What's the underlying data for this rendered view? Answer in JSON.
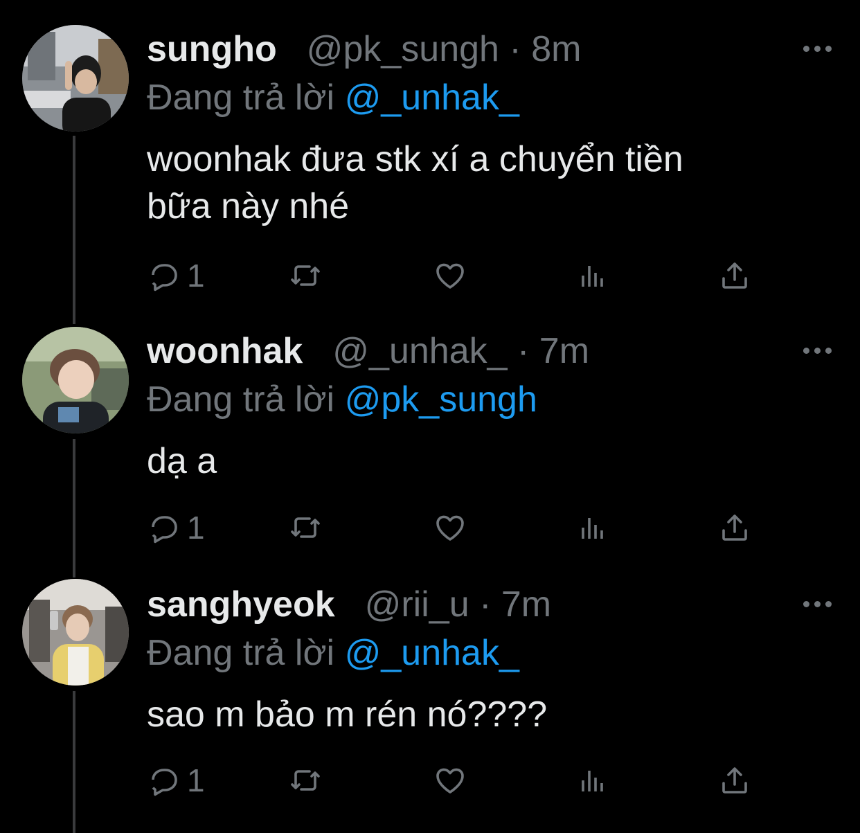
{
  "tweets": [
    {
      "display_name": "sungho",
      "handle": "@pk_sungh",
      "separator": "·",
      "time": "8m",
      "reply_prefix": "Đang trả lời",
      "reply_handle": "@_unhak_",
      "text_lines": [
        "woonhak đưa stk xí a chuyển tiền",
        "bữa này nhé"
      ],
      "reply_count": "1"
    },
    {
      "display_name": "woonhak",
      "handle": "@_unhak_",
      "separator": "·",
      "time": "7m",
      "reply_prefix": "Đang trả lời",
      "reply_handle": "@pk_sungh",
      "text_lines": [
        "dạ a"
      ],
      "reply_count": "1"
    },
    {
      "display_name": "sanghyeok",
      "handle": "@rii_u",
      "separator": "·",
      "time": "7m",
      "reply_prefix": "Đang trả lời",
      "reply_handle": "@_unhak_",
      "text_lines": [
        "sao m bảo m rén nó????"
      ],
      "reply_count": "1"
    }
  ],
  "icons": {
    "reply": "reply-icon",
    "retweet": "retweet-icon",
    "like": "heart-icon",
    "views": "views-icon",
    "share": "share-icon",
    "more": "more-icon"
  },
  "colors": {
    "background": "#000000",
    "primary_text": "#e7e9ea",
    "secondary_text": "#71767b",
    "link": "#1d9bf0",
    "thread_line": "#3a3b3d"
  }
}
